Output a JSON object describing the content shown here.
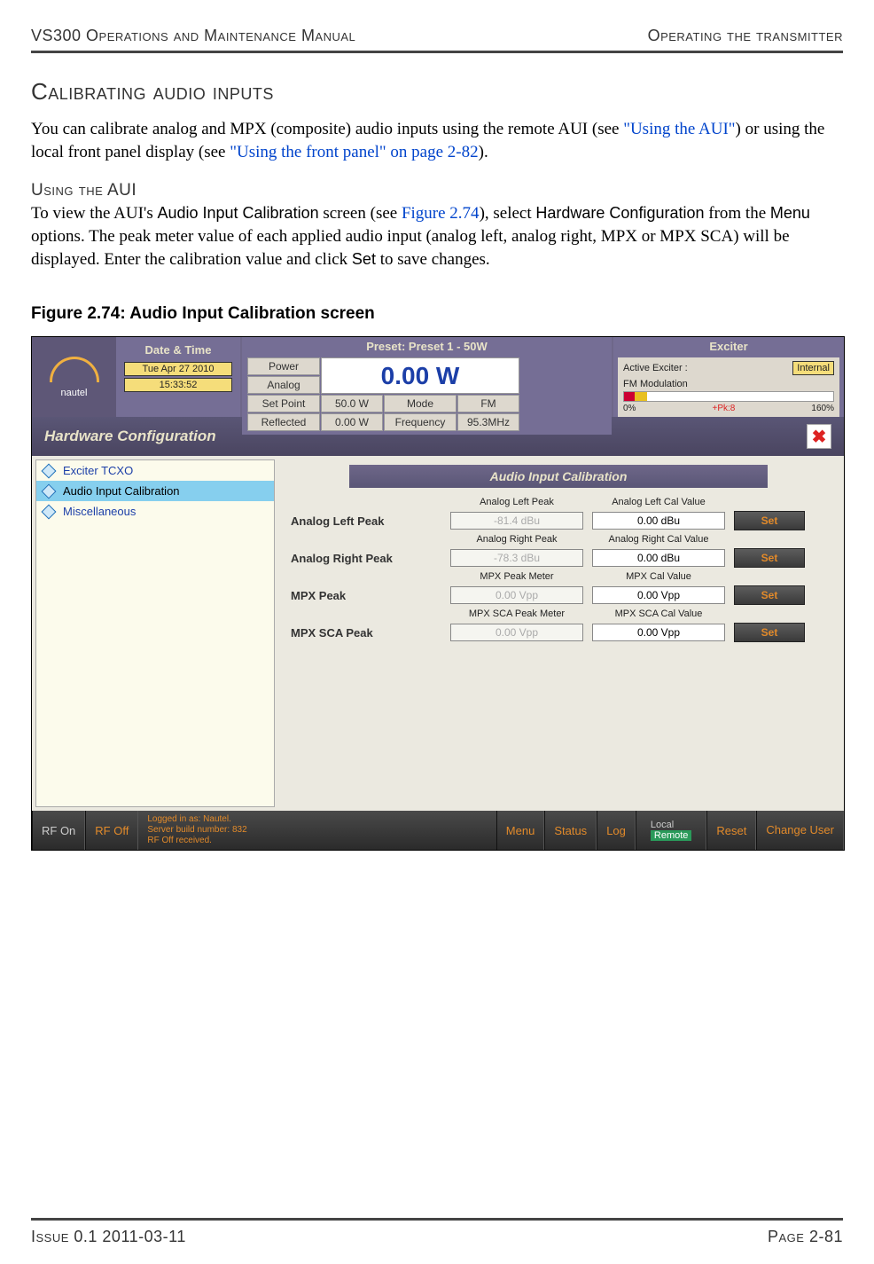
{
  "header": {
    "left": "VS300 Operations and Maintenance Manual",
    "right": "Operating the transmitter"
  },
  "section_title": "Calibrating audio inputs",
  "para1_a": "You can calibrate analog and MPX (composite) audio inputs using the remote AUI (see ",
  "para1_link1": "\"Using the AUI\"",
  "para1_b": ") or using the local front panel display (see ",
  "para1_link2": "\"Using the front panel\" on page 2-82",
  "para1_c": ").",
  "sub_title": "Using the AUI",
  "para2_a": "To view the AUI's ",
  "para2_b": "Audio Input Calibration",
  "para2_c": " screen (see ",
  "para2_link": "Figure 2.74",
  "para2_d": "), select ",
  "para2_e": "Hardware Configuration",
  "para2_f": " from the ",
  "para2_g": "Menu",
  "para2_h": " options. The peak meter value of each applied audio input (analog left, analog right, MPX or MPX SCA) will be displayed. Enter the calibration value and click ",
  "para2_i": "Set",
  "para2_j": " to save changes.",
  "fig_caption": "Figure 2.74: Audio Input Calibration screen",
  "aui": {
    "logo": "nautel",
    "datetime": {
      "title": "Date & Time",
      "date": "Tue Apr 27 2010",
      "time": "15:33:52"
    },
    "preset": {
      "title": "Preset: Preset 1 - 50W",
      "power": "Power",
      "analog": "Analog",
      "big": "0.00 W",
      "setpoint_l": "Set Point",
      "setpoint_v": "50.0 W",
      "mode_l": "Mode",
      "mode_v": "FM",
      "refl_l": "Reflected",
      "refl_v": "0.00 W",
      "freq_l": "Frequency",
      "freq_v": "95.3MHz"
    },
    "exciter": {
      "title": "Exciter",
      "active_l": "Active Exciter :",
      "active_v": "Internal",
      "mod": "FM Modulation",
      "scale_l": "0%",
      "scale_pk": "+Pk:8",
      "scale_r": "160%"
    },
    "hw_title": "Hardware Configuration",
    "tree": [
      "Exciter TCXO",
      "Audio Input Calibration",
      "Miscellaneous"
    ],
    "aic_title": "Audio Input Calibration",
    "rows": [
      {
        "label": "Analog Left Peak",
        "h1": "Analog Left Peak",
        "h2": "Analog Left Cal Value",
        "v1": "-81.4 dBu",
        "v2": "0.00 dBu",
        "btn": "Set"
      },
      {
        "label": "Analog Right Peak",
        "h1": "Analog Right Peak",
        "h2": "Analog Right Cal Value",
        "v1": "-78.3 dBu",
        "v2": "0.00 dBu",
        "btn": "Set"
      },
      {
        "label": "MPX Peak",
        "h1": "MPX Peak Meter",
        "h2": "MPX Cal Value",
        "v1": "0.00 Vpp",
        "v2": "0.00 Vpp",
        "btn": "Set"
      },
      {
        "label": "MPX SCA Peak",
        "h1": "MPX SCA Peak Meter",
        "h2": "MPX SCA Cal Value",
        "v1": "0.00 Vpp",
        "v2": "0.00 Vpp",
        "btn": "Set"
      }
    ],
    "footer": {
      "rf_on": "RF On",
      "rf_off": "RF Off",
      "log1": "Logged in as:    Nautel.",
      "log2": "Server build number: 832",
      "log3": "RF Off received.",
      "menu": "Menu",
      "status": "Status",
      "log": "Log",
      "local": "Local",
      "remote": "Remote",
      "reset": "Reset",
      "change": "Change User"
    }
  },
  "footer": {
    "left": "Issue 0.1  2011-03-11",
    "right": "Page 2-81"
  }
}
